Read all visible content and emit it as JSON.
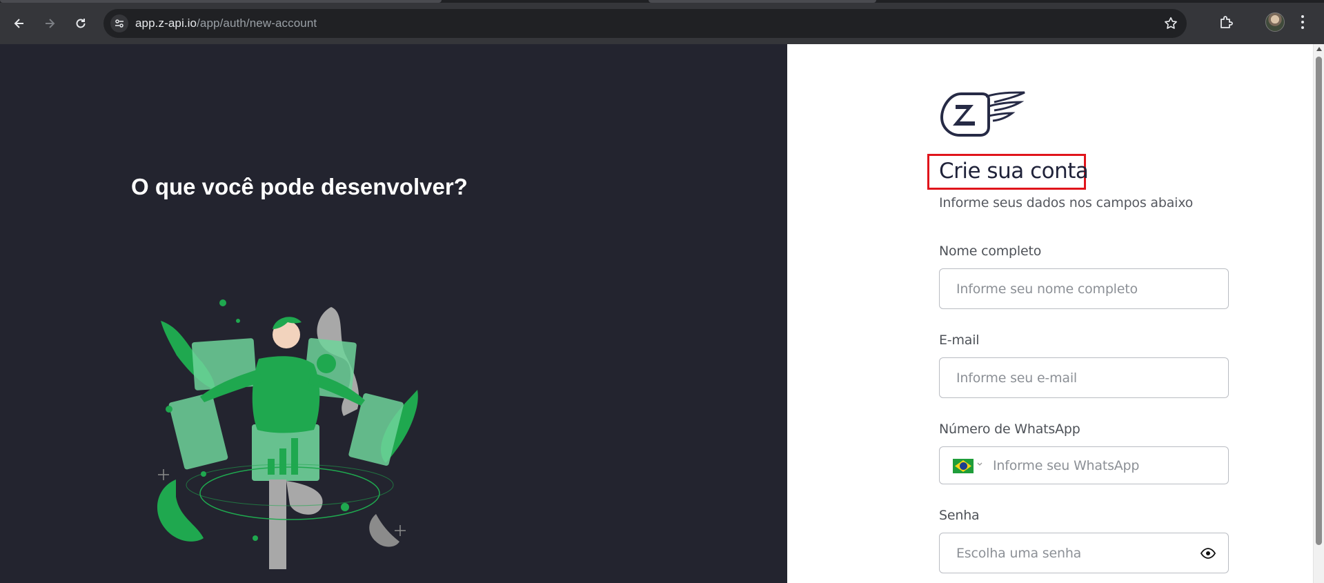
{
  "browser": {
    "url_host": "app.z-api.io",
    "url_path": "/app/auth/new-account"
  },
  "hero": {
    "title": "O que você pode desenvolver?"
  },
  "form": {
    "heading": "Crie sua conta",
    "subheading": "Informe seus dados nos campos abaixo",
    "fields": {
      "name": {
        "label": "Nome completo",
        "placeholder": "Informe seu nome completo"
      },
      "email": {
        "label": "E-mail",
        "placeholder": "Informe seu e-mail"
      },
      "whatsapp": {
        "label": "Número de WhatsApp",
        "placeholder": "Informe seu WhatsApp",
        "country_icon": "brazil-flag-icon"
      },
      "password": {
        "label": "Senha",
        "placeholder": "Escolha uma senha",
        "toggle_icon": "eye-icon"
      }
    }
  },
  "colors": {
    "left_panel_bg": "#23242f",
    "highlight_border": "#e0141b",
    "illustration_green": "#1fa84f",
    "brand_navy": "#262a45"
  }
}
